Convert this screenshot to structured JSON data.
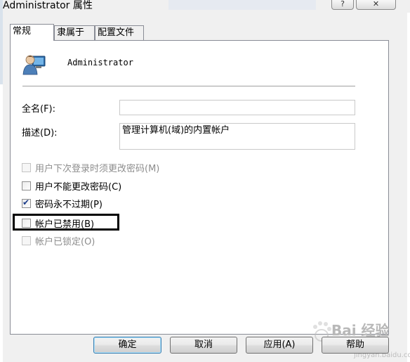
{
  "window": {
    "title": "Administrator 属性",
    "help_label": "?",
    "close_label": "✕"
  },
  "tabs": [
    {
      "label": "常规",
      "active": true
    },
    {
      "label": "隶属于",
      "active": false
    },
    {
      "label": "配置文件",
      "active": false
    }
  ],
  "user": {
    "icon": "user-icon",
    "name": "Administrator"
  },
  "fields": {
    "fullname_label": "全名(F):",
    "fullname_value": "",
    "description_label": "描述(D):",
    "description_value": "管理计算机(域)的内置帐户"
  },
  "checkboxes": [
    {
      "label": "用户下次登录时须更改密码(M)",
      "checked": false,
      "enabled": false
    },
    {
      "label": "用户不能更改密码(C)",
      "checked": false,
      "enabled": true
    },
    {
      "label": "密码永不过期(P)",
      "checked": true,
      "enabled": true
    },
    {
      "label": "帐户已禁用(B)",
      "checked": false,
      "enabled": true
    },
    {
      "label": "帐户已锁定(O)",
      "checked": false,
      "enabled": false
    }
  ],
  "buttons": {
    "ok": "确定",
    "cancel": "取消",
    "apply": "应用(A)",
    "help": "帮助"
  },
  "watermark": {
    "text": "Bai 经验",
    "sub": "jingyan.baidu.com"
  }
}
